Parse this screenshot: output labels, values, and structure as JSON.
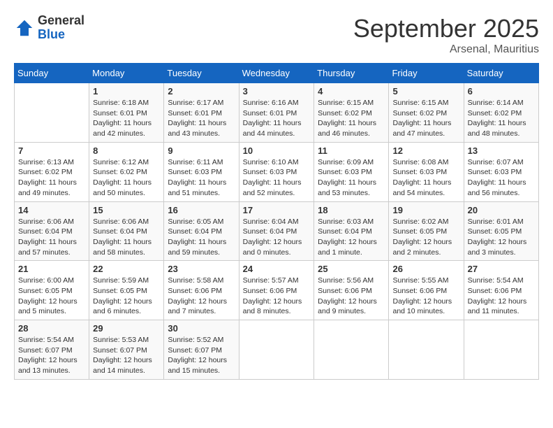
{
  "logo": {
    "general": "General",
    "blue": "Blue"
  },
  "title": "September 2025",
  "location": "Arsenal, Mauritius",
  "days_header": [
    "Sunday",
    "Monday",
    "Tuesday",
    "Wednesday",
    "Thursday",
    "Friday",
    "Saturday"
  ],
  "weeks": [
    [
      {
        "day": "",
        "sunrise": "",
        "sunset": "",
        "daylight": ""
      },
      {
        "day": "1",
        "sunrise": "Sunrise: 6:18 AM",
        "sunset": "Sunset: 6:01 PM",
        "daylight": "Daylight: 11 hours and 42 minutes."
      },
      {
        "day": "2",
        "sunrise": "Sunrise: 6:17 AM",
        "sunset": "Sunset: 6:01 PM",
        "daylight": "Daylight: 11 hours and 43 minutes."
      },
      {
        "day": "3",
        "sunrise": "Sunrise: 6:16 AM",
        "sunset": "Sunset: 6:01 PM",
        "daylight": "Daylight: 11 hours and 44 minutes."
      },
      {
        "day": "4",
        "sunrise": "Sunrise: 6:15 AM",
        "sunset": "Sunset: 6:02 PM",
        "daylight": "Daylight: 11 hours and 46 minutes."
      },
      {
        "day": "5",
        "sunrise": "Sunrise: 6:15 AM",
        "sunset": "Sunset: 6:02 PM",
        "daylight": "Daylight: 11 hours and 47 minutes."
      },
      {
        "day": "6",
        "sunrise": "Sunrise: 6:14 AM",
        "sunset": "Sunset: 6:02 PM",
        "daylight": "Daylight: 11 hours and 48 minutes."
      }
    ],
    [
      {
        "day": "7",
        "sunrise": "Sunrise: 6:13 AM",
        "sunset": "Sunset: 6:02 PM",
        "daylight": "Daylight: 11 hours and 49 minutes."
      },
      {
        "day": "8",
        "sunrise": "Sunrise: 6:12 AM",
        "sunset": "Sunset: 6:02 PM",
        "daylight": "Daylight: 11 hours and 50 minutes."
      },
      {
        "day": "9",
        "sunrise": "Sunrise: 6:11 AM",
        "sunset": "Sunset: 6:03 PM",
        "daylight": "Daylight: 11 hours and 51 minutes."
      },
      {
        "day": "10",
        "sunrise": "Sunrise: 6:10 AM",
        "sunset": "Sunset: 6:03 PM",
        "daylight": "Daylight: 11 hours and 52 minutes."
      },
      {
        "day": "11",
        "sunrise": "Sunrise: 6:09 AM",
        "sunset": "Sunset: 6:03 PM",
        "daylight": "Daylight: 11 hours and 53 minutes."
      },
      {
        "day": "12",
        "sunrise": "Sunrise: 6:08 AM",
        "sunset": "Sunset: 6:03 PM",
        "daylight": "Daylight: 11 hours and 54 minutes."
      },
      {
        "day": "13",
        "sunrise": "Sunrise: 6:07 AM",
        "sunset": "Sunset: 6:03 PM",
        "daylight": "Daylight: 11 hours and 56 minutes."
      }
    ],
    [
      {
        "day": "14",
        "sunrise": "Sunrise: 6:06 AM",
        "sunset": "Sunset: 6:04 PM",
        "daylight": "Daylight: 11 hours and 57 minutes."
      },
      {
        "day": "15",
        "sunrise": "Sunrise: 6:06 AM",
        "sunset": "Sunset: 6:04 PM",
        "daylight": "Daylight: 11 hours and 58 minutes."
      },
      {
        "day": "16",
        "sunrise": "Sunrise: 6:05 AM",
        "sunset": "Sunset: 6:04 PM",
        "daylight": "Daylight: 11 hours and 59 minutes."
      },
      {
        "day": "17",
        "sunrise": "Sunrise: 6:04 AM",
        "sunset": "Sunset: 6:04 PM",
        "daylight": "Daylight: 12 hours and 0 minutes."
      },
      {
        "day": "18",
        "sunrise": "Sunrise: 6:03 AM",
        "sunset": "Sunset: 6:04 PM",
        "daylight": "Daylight: 12 hours and 1 minute."
      },
      {
        "day": "19",
        "sunrise": "Sunrise: 6:02 AM",
        "sunset": "Sunset: 6:05 PM",
        "daylight": "Daylight: 12 hours and 2 minutes."
      },
      {
        "day": "20",
        "sunrise": "Sunrise: 6:01 AM",
        "sunset": "Sunset: 6:05 PM",
        "daylight": "Daylight: 12 hours and 3 minutes."
      }
    ],
    [
      {
        "day": "21",
        "sunrise": "Sunrise: 6:00 AM",
        "sunset": "Sunset: 6:05 PM",
        "daylight": "Daylight: 12 hours and 5 minutes."
      },
      {
        "day": "22",
        "sunrise": "Sunrise: 5:59 AM",
        "sunset": "Sunset: 6:05 PM",
        "daylight": "Daylight: 12 hours and 6 minutes."
      },
      {
        "day": "23",
        "sunrise": "Sunrise: 5:58 AM",
        "sunset": "Sunset: 6:06 PM",
        "daylight": "Daylight: 12 hours and 7 minutes."
      },
      {
        "day": "24",
        "sunrise": "Sunrise: 5:57 AM",
        "sunset": "Sunset: 6:06 PM",
        "daylight": "Daylight: 12 hours and 8 minutes."
      },
      {
        "day": "25",
        "sunrise": "Sunrise: 5:56 AM",
        "sunset": "Sunset: 6:06 PM",
        "daylight": "Daylight: 12 hours and 9 minutes."
      },
      {
        "day": "26",
        "sunrise": "Sunrise: 5:55 AM",
        "sunset": "Sunset: 6:06 PM",
        "daylight": "Daylight: 12 hours and 10 minutes."
      },
      {
        "day": "27",
        "sunrise": "Sunrise: 5:54 AM",
        "sunset": "Sunset: 6:06 PM",
        "daylight": "Daylight: 12 hours and 11 minutes."
      }
    ],
    [
      {
        "day": "28",
        "sunrise": "Sunrise: 5:54 AM",
        "sunset": "Sunset: 6:07 PM",
        "daylight": "Daylight: 12 hours and 13 minutes."
      },
      {
        "day": "29",
        "sunrise": "Sunrise: 5:53 AM",
        "sunset": "Sunset: 6:07 PM",
        "daylight": "Daylight: 12 hours and 14 minutes."
      },
      {
        "day": "30",
        "sunrise": "Sunrise: 5:52 AM",
        "sunset": "Sunset: 6:07 PM",
        "daylight": "Daylight: 12 hours and 15 minutes."
      },
      {
        "day": "",
        "sunrise": "",
        "sunset": "",
        "daylight": ""
      },
      {
        "day": "",
        "sunrise": "",
        "sunset": "",
        "daylight": ""
      },
      {
        "day": "",
        "sunrise": "",
        "sunset": "",
        "daylight": ""
      },
      {
        "day": "",
        "sunrise": "",
        "sunset": "",
        "daylight": ""
      }
    ]
  ]
}
